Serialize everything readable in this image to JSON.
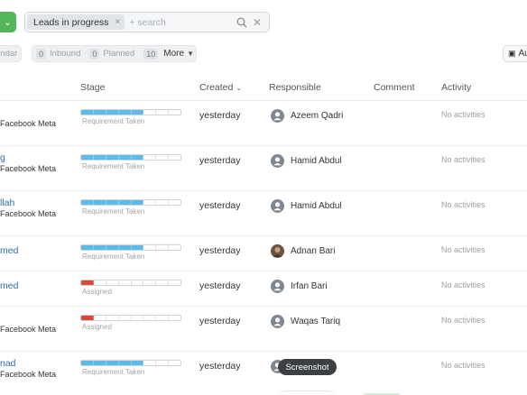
{
  "toolbar": {
    "green_button_icon": "chevron-down",
    "filter_chip_label": "Leads in progress",
    "filter_chip_remove": "×",
    "search_placeholder": "+ search",
    "clear_glyph": "✕"
  },
  "quick_filters": {
    "calendar_label": "endar",
    "inbound_count": "0",
    "inbound_label": "Inbound",
    "planned_count": "0",
    "planned_label": "Planned",
    "more_count": "10",
    "more_label": "More",
    "automation_label": "Au"
  },
  "table": {
    "headers": {
      "stage": "Stage",
      "created": "Created",
      "responsible": "Responsible",
      "comment": "Comment",
      "activity": "Activity"
    },
    "rows": [
      {
        "name": "",
        "source": "Facebook Meta",
        "stage": "Requirement Taken",
        "stage_filled": 5,
        "stage_color": "#5bbbe9",
        "created": "yesterday",
        "responsible": "Azeem Qadri",
        "avatar": "default",
        "activity": "No activities"
      },
      {
        "name": "g",
        "source": "Facebook Meta",
        "stage": "Requirement Taken",
        "stage_filled": 5,
        "stage_color": "#5bbbe9",
        "created": "yesterday",
        "responsible": "Hamid Abdul",
        "avatar": "default",
        "activity": "No activities"
      },
      {
        "name": "llah",
        "source": "Facebook Meta",
        "stage": "Requirement Taken",
        "stage_filled": 5,
        "stage_color": "#5bbbe9",
        "created": "yesterday",
        "responsible": "Hamid Abdul",
        "avatar": "default",
        "activity": "No activities"
      },
      {
        "name": "med",
        "source": "",
        "stage": "Requirement Taken",
        "stage_filled": 5,
        "stage_color": "#5bbbe9",
        "created": "yesterday",
        "responsible": "Adnan Bari",
        "avatar": "photo",
        "activity": "No activities"
      },
      {
        "name": "med",
        "source": "",
        "stage": "Assigned",
        "stage_filled": 1,
        "stage_color": "#d9463b",
        "created": "yesterday",
        "responsible": "Irfan Bari",
        "avatar": "default",
        "activity": "No activities"
      },
      {
        "name": "",
        "source": "Facebook Meta",
        "stage": "Assigned",
        "stage_filled": 1,
        "stage_color": "#d9463b",
        "created": "yesterday",
        "responsible": "Waqas Tariq",
        "avatar": "default",
        "activity": "No activities"
      },
      {
        "name": "nad",
        "source": "Facebook Meta",
        "stage": "Requirement Taken",
        "stage_filled": 5,
        "stage_color": "#5bbbe9",
        "created": "yesterday",
        "responsible": "",
        "avatar": "default",
        "activity": "No activities"
      }
    ],
    "stage_segments_total": 8
  },
  "tooltip": {
    "label": "Screenshot"
  }
}
